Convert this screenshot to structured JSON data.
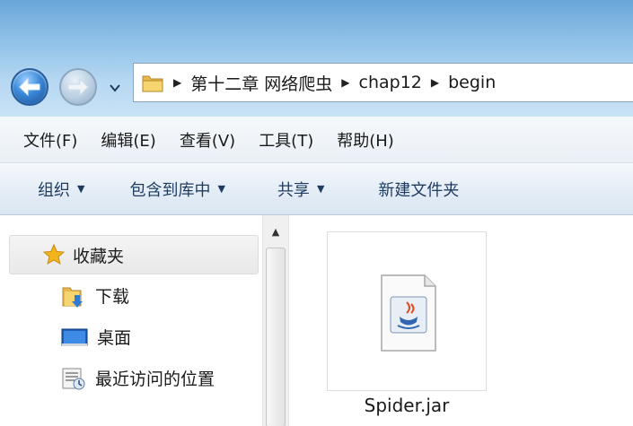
{
  "address_bar": {
    "crumbs": [
      "第十二章 网络爬虫",
      "chap12",
      "begin"
    ]
  },
  "menubar": {
    "items": [
      "文件(F)",
      "编辑(E)",
      "查看(V)",
      "工具(T)",
      "帮助(H)"
    ]
  },
  "toolbar": {
    "organize": "组织",
    "include_in_library": "包含到库中",
    "share": "共享",
    "new_folder": "新建文件夹"
  },
  "navpane": {
    "favorites": "收藏夹",
    "items": [
      "下载",
      "桌面",
      "最近访问的位置"
    ]
  },
  "files": [
    {
      "name": "Spider.jar",
      "icon": "java-jar-icon"
    }
  ],
  "icons": {
    "back": "back-arrow-icon",
    "forward": "forward-arrow-icon",
    "recent": "chevron-down-icon",
    "folder": "folder-icon",
    "favorites": "star-icon",
    "downloads": "downloads-folder-icon",
    "desktop": "desktop-icon",
    "recent_places": "recent-places-icon"
  },
  "colors": {
    "aero_blue": "#8fc1e8",
    "toolbar_text": "#1e3a5f",
    "star": "#f2b51c"
  }
}
